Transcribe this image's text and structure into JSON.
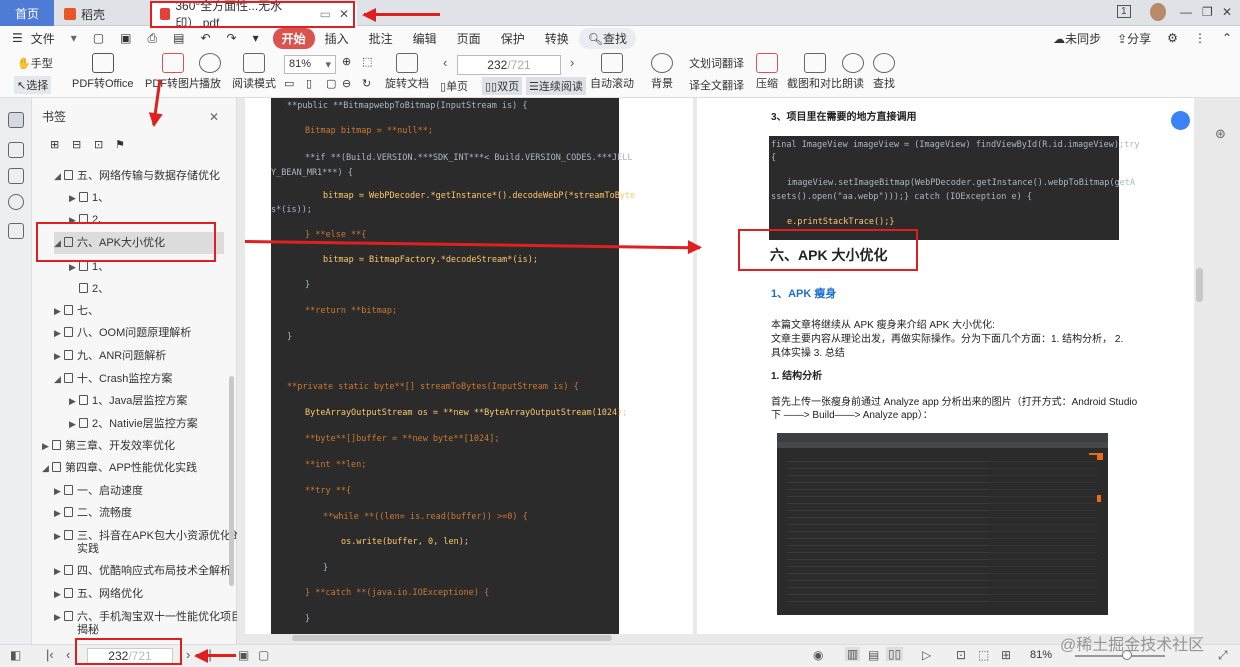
{
  "tabs": {
    "home": "首页",
    "daoke": "稻壳",
    "pdf": "360°全方面性...无水印）.pdf",
    "add": "+"
  },
  "window": {
    "page_box": "1"
  },
  "menu": {
    "file": "文件",
    "items": [
      "开始",
      "插入",
      "批注",
      "编辑",
      "页面",
      "保护",
      "转换"
    ],
    "search": "查找",
    "sync": "未同步",
    "share": "分享"
  },
  "ribbon": {
    "hand": "手型",
    "select": "选择",
    "pdf_office": "PDF转Office",
    "pdf_img": "PDF转图片",
    "play": "播放",
    "read_mode": "阅读模式",
    "zoom": "81%",
    "rotate": "旋转文档",
    "page_current": "232",
    "page_total": "/721",
    "single": "单页",
    "double": "双页",
    "continuous": "连续阅读",
    "auto_scroll": "自动滚动",
    "background": "背景",
    "word_trans": "划词翻译",
    "full_trans": "全文翻译",
    "compress": "压缩",
    "screenshot": "截图和对比",
    "read_aloud": "朗读",
    "find": "查找"
  },
  "bookmarks": {
    "title": "书签",
    "items": [
      "五、网络传输与数据存储优化",
      "1、",
      "2、",
      "六、APK大小优化",
      "1、",
      "2、",
      "七、",
      "八、OOM问题原理解析",
      "九、ANR问题解析",
      "十、Crash监控方案",
      "1、Java层监控方案",
      "2、Nativie层监控方案",
      "第三章、开发效率优化",
      "第四章、APP性能优化实践",
      "一、启动速度",
      "二、流畅度",
      "三、抖音在APK包大小资源优化的",
      "实践",
      "四、优酷响应式布局技术全解析",
      "五、网络优化",
      "六、手机淘宝双十一性能优化项目",
      "揭秘"
    ]
  },
  "left_code": [
    "**public **BitmapwebpToBitmap(InputStream is) {",
    "Bitmap bitmap = **null**;",
    "**if **(Build.VERSION.***SDK_INT***< Build.VERSION_CODES.***JELL",
    "Y_BEAN_MR1***) {",
    "bitmap = WebPDecoder.*getInstance*().decodeWebP(*streamToByte",
    "s*(is));",
    "} **else **{",
    "bitmap = BitmapFactory.*decodeStream*(is);",
    "}",
    "**return **bitmap;",
    "}",
    "**private static byte**[] streamToBytes(InputStream is) {",
    "ByteArrayOutputStream os = **new **ByteArrayOutputStream(1024);",
    "**byte**[]buffer = **new byte**[1024];",
    "**int **len;",
    "**try **{",
    "**while **((len= is.read(buffer)) >=0) {",
    "os.write(buffer, 0, len);",
    "}",
    "} **catch **(java.io.IOExceptione) {",
    "}"
  ],
  "right_doc": {
    "step3": "3、项目里在需要的地方直接调用",
    "code": [
      "final ImageView imageView = (ImageView) findViewById(R.id.imageView);try",
      "{",
      "imageView.setImageBitmap(WebPDecoder.getInstance().webpToBitmap(getA",
      "ssets().open(\"aa.webp\")));} catch (IOException e) {",
      "e.printStackTrace();}"
    ],
    "heading": "六、APK 大小优化",
    "sub1": "1、APK 瘦身",
    "para1": "本篇文章将继续从 APK 瘦身来介绍 APK 大小优化:",
    "para2": "文章主要内容从理论出发，再做实际操作。分为下面几个方面：1. 结构分析，  2.",
    "para3": "具体实操  3. 总结",
    "sub2": "1.  结构分析",
    "para4": "首先上传一张瘦身前通过 Analyze app 分析出来的图片（打开方式：Android Studio",
    "para5": "下  ——> Build——> Analyze app）："
  },
  "status": {
    "page_current": "232",
    "page_total": "/721",
    "zoom": "81%",
    "watermark": "@稀土掘金技术社区"
  },
  "colors": {
    "accent": "#d9534f",
    "annotation": "#e02020",
    "link_blue": "#1a6fd1"
  }
}
